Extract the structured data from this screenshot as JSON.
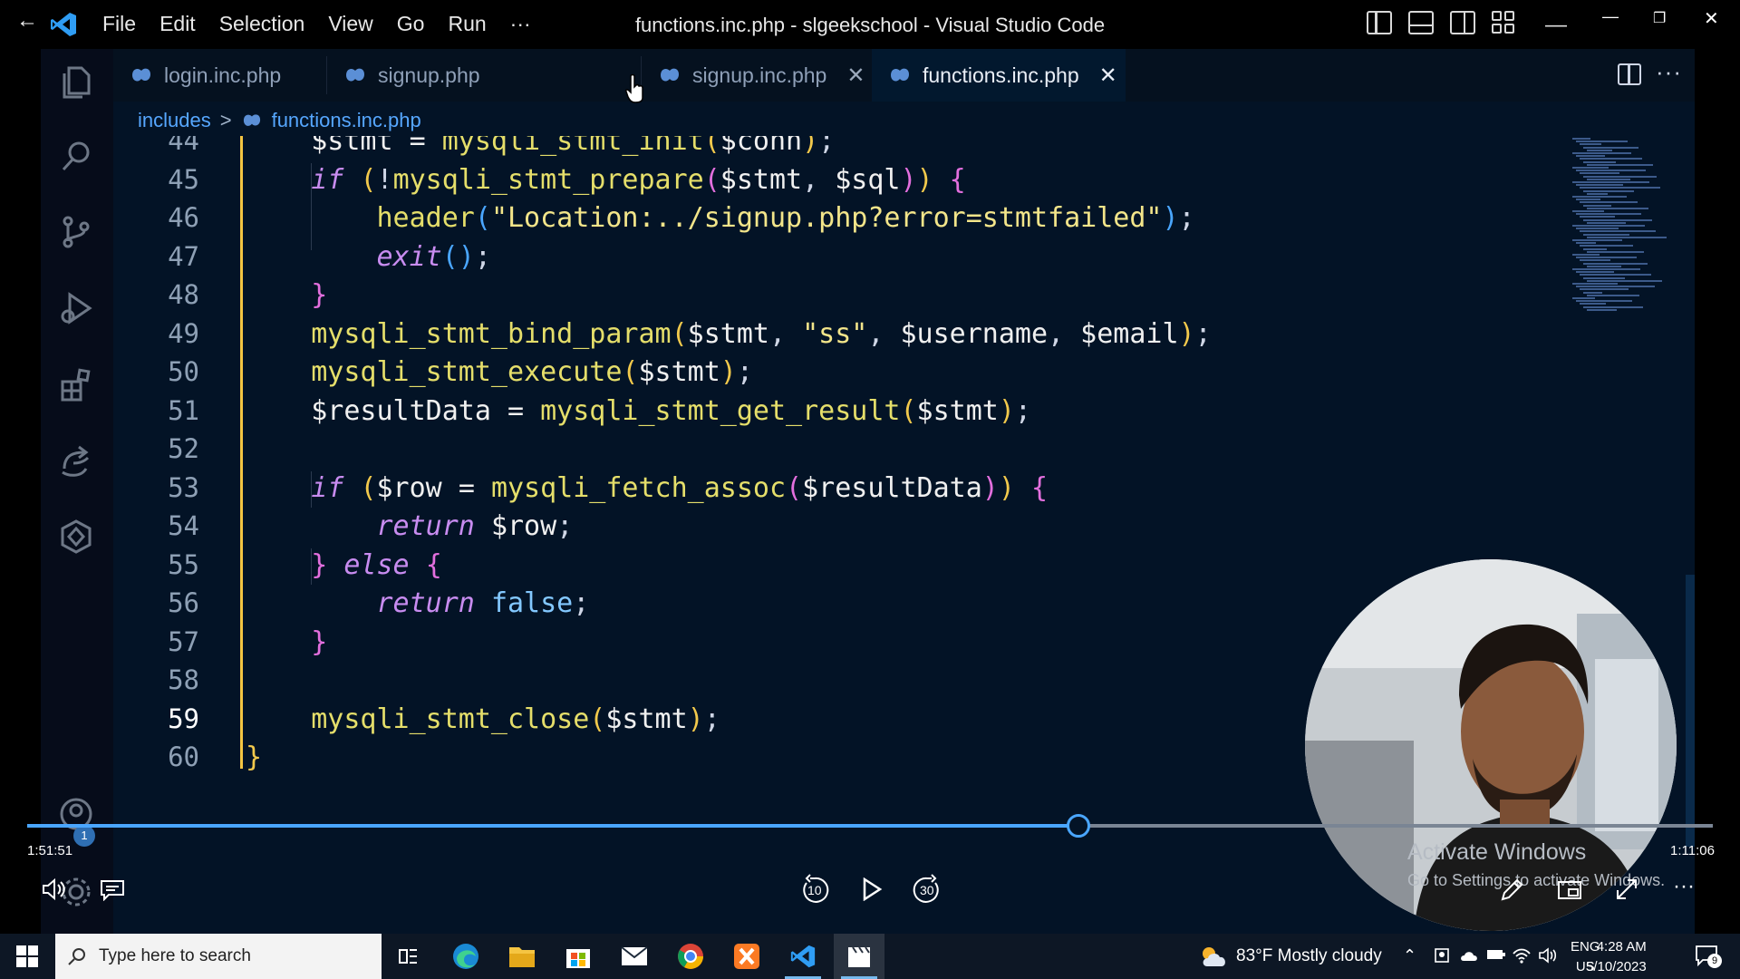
{
  "window": {
    "title": "functions.inc.php - slgeekschool - Visual Studio Code",
    "menu": [
      "File",
      "Edit",
      "Selection",
      "View",
      "Go",
      "Run",
      "···"
    ]
  },
  "tabs": [
    {
      "label": "login.inc.php",
      "active": false,
      "closable": false
    },
    {
      "label": "signup.php",
      "active": false,
      "closable": false
    },
    {
      "label": "signup.inc.php",
      "active": false,
      "closable": true
    },
    {
      "label": "functions.inc.php",
      "active": true,
      "closable": true
    }
  ],
  "breadcrumb": {
    "folder": "includes",
    "file": "functions.inc.php"
  },
  "code": {
    "current_line": "59",
    "lines": [
      {
        "n": "44",
        "html": "    <span class='var'>$stmt</span> <span class='op'>=</span> <span class='fn'>mysqli_stmt_init</span><span class='p1'>(</span><span class='var'>$conn</span><span class='p1'>)</span>;"
      },
      {
        "n": "45",
        "html": "    <span class='kw'>if</span> <span class='p1'>(</span>!<span class='fn'>mysqli_stmt_prepare</span><span class='p2'>(</span><span class='var'>$stmt</span>, <span class='var'>$sql</span><span class='p2'>)</span><span class='p1'>)</span> <span class='p2'>{</span>"
      },
      {
        "n": "46",
        "html": "        <span class='fn'>header</span><span class='p3'>(</span><span class='str'>\"Location:../signup.php?error=stmtfailed\"</span><span class='p3'>)</span>;"
      },
      {
        "n": "47",
        "html": "        <span class='kw'>exit</span><span class='p3'>()</span>;"
      },
      {
        "n": "48",
        "html": "    <span class='p2'>}</span>"
      },
      {
        "n": "49",
        "html": "    <span class='fn'>mysqli_stmt_bind_param</span><span class='p1'>(</span><span class='var'>$stmt</span>, <span class='str'>\"ss\"</span>, <span class='var'>$username</span>, <span class='var'>$email</span><span class='p1'>)</span>;"
      },
      {
        "n": "50",
        "html": "    <span class='fn'>mysqli_stmt_execute</span><span class='p1'>(</span><span class='var'>$stmt</span><span class='p1'>)</span>;"
      },
      {
        "n": "51",
        "html": "    <span class='var'>$resultData</span> <span class='op'>=</span> <span class='fn'>mysqli_stmt_get_result</span><span class='p1'>(</span><span class='var'>$stmt</span><span class='p1'>)</span>;"
      },
      {
        "n": "52",
        "html": ""
      },
      {
        "n": "53",
        "html": "    <span class='kw'>if</span> <span class='p1'>(</span><span class='var'>$row</span> <span class='op'>=</span> <span class='fn'>mysqli_fetch_assoc</span><span class='p2'>(</span><span class='var'>$resultData</span><span class='p2'>)</span><span class='p1'>)</span> <span class='p2'>{</span>"
      },
      {
        "n": "54",
        "html": "        <span class='kw'>return</span> <span class='var'>$row</span>;"
      },
      {
        "n": "55",
        "html": "    <span class='p2'>}</span> <span class='kw'>else</span> <span class='p2'>{</span>"
      },
      {
        "n": "56",
        "html": "        <span class='kw'>return</span> <span class='bool'>false</span>;"
      },
      {
        "n": "57",
        "html": "    <span class='p2'>}</span>"
      },
      {
        "n": "58",
        "html": ""
      },
      {
        "n": "59",
        "html": "    <span class='fn'>mysqli_stmt_close</span><span class='p1'>(</span><span class='var'>$stmt</span><span class='p1'>)</span>;"
      },
      {
        "n": "60",
        "html": "<span class='p1'>}</span>"
      }
    ]
  },
  "player": {
    "elapsed": "1:51:51",
    "remaining": "1:11:06",
    "progress": 0.5,
    "skip_back": "10",
    "skip_forward": "30",
    "notification_badge": "1"
  },
  "watermark": {
    "line1": "Activate Windows",
    "line2": "Go to Settings to activate Windows."
  },
  "taskbar": {
    "search_placeholder": "Type here to search",
    "weather": "83°F  Mostly cloudy",
    "lang1": "ENG",
    "lang2": "US",
    "time": "4:28 AM",
    "date": "5/10/2023",
    "notifications": "9"
  },
  "colors": {
    "accent": "#4aa6ff",
    "editor_bg": "#031326",
    "guide": "#f4c542"
  }
}
